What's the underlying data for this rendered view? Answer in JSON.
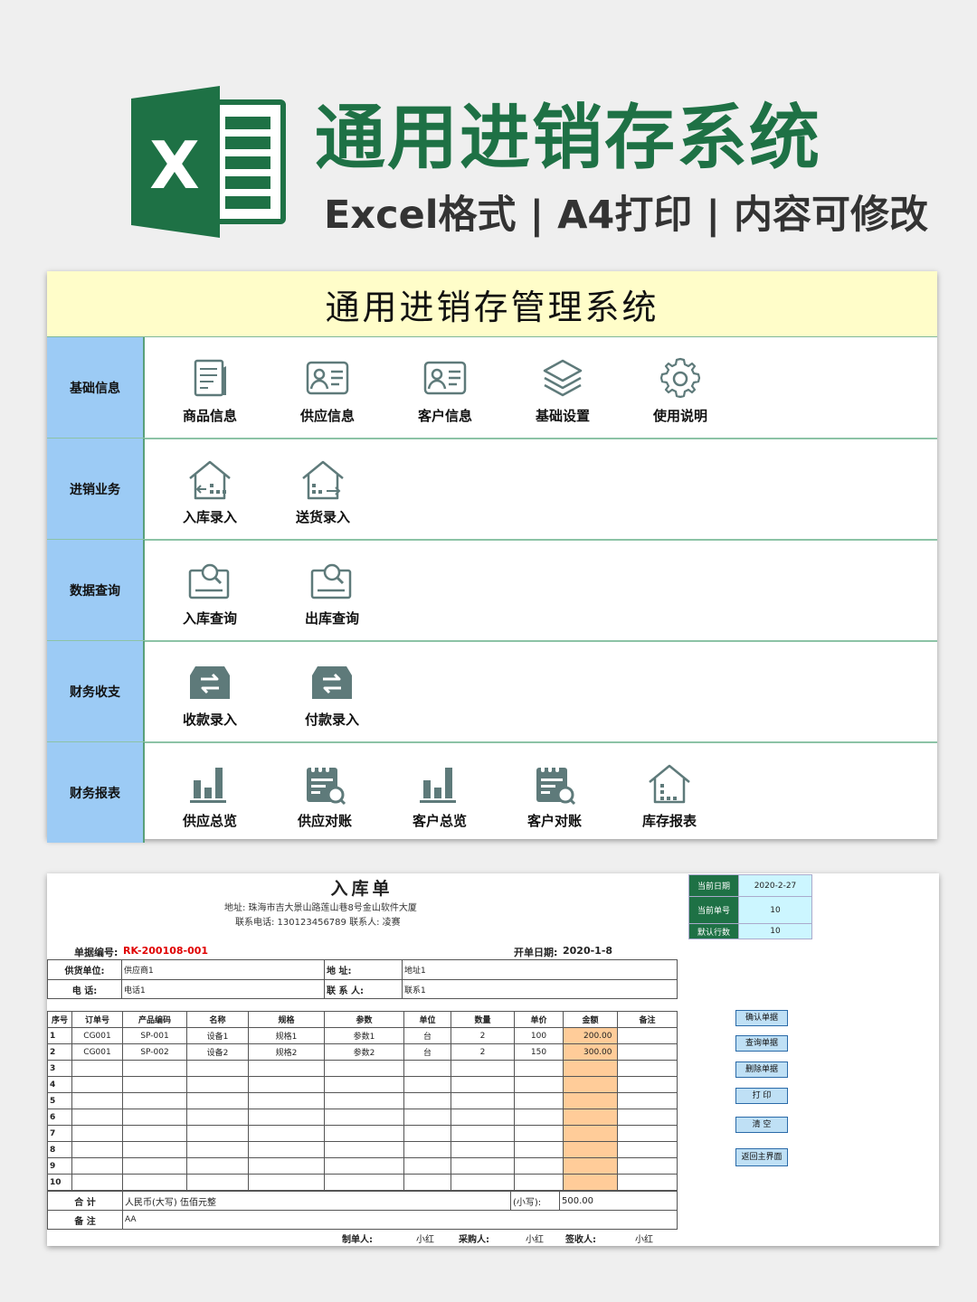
{
  "banner": {
    "title": "通用进销存系统",
    "subtitle": "Excel格式 | A4打印 | 内容可修改",
    "logo_letter": "X",
    "brand_color": "#1e7145"
  },
  "menu": {
    "title": "通用进销存管理系统",
    "rows": [
      {
        "category": "基础信息",
        "items": [
          {
            "label": "商品信息",
            "icon": "document-icon"
          },
          {
            "label": "供应信息",
            "icon": "id-card-icon"
          },
          {
            "label": "客户信息",
            "icon": "id-card-icon"
          },
          {
            "label": "基础设置",
            "icon": "layers-icon"
          },
          {
            "label": "使用说明",
            "icon": "gear-icon"
          }
        ]
      },
      {
        "category": "进销业务",
        "items": [
          {
            "label": "入库录入",
            "icon": "warehouse-in-icon"
          },
          {
            "label": "送货录入",
            "icon": "warehouse-out-icon"
          }
        ]
      },
      {
        "category": "数据查询",
        "items": [
          {
            "label": "入库查询",
            "icon": "search-card-icon"
          },
          {
            "label": "出库查询",
            "icon": "search-card-icon"
          }
        ]
      },
      {
        "category": "财务收支",
        "items": [
          {
            "label": "收款录入",
            "icon": "exchange-icon"
          },
          {
            "label": "付款录入",
            "icon": "exchange-icon"
          }
        ]
      },
      {
        "category": "财务报表",
        "items": [
          {
            "label": "供应总览",
            "icon": "bar-chart-icon"
          },
          {
            "label": "供应对账",
            "icon": "ledger-search-icon"
          },
          {
            "label": "客户总览",
            "icon": "bar-chart-icon"
          },
          {
            "label": "客户对账",
            "icon": "ledger-search-icon"
          },
          {
            "label": "库存报表",
            "icon": "warehouse-icon"
          }
        ]
      }
    ]
  },
  "form": {
    "title": "入库单",
    "address": "地址:  珠海市吉大景山路莲山巷8号金山软件大厦",
    "contact": "联系电话: 130123456789   联系人: 凌赛",
    "doc_no_label": "单据编号:",
    "doc_no": "RK-200108-001",
    "date_label": "开单日期:",
    "date": "2020-1-8",
    "supplier_label": "供货单位:",
    "supplier": "供应商1",
    "address_label": "地   址:",
    "address_value": "地址1",
    "phone_label": "电   话:",
    "phone": "电话1",
    "person_label": "联 系 人:",
    "person": "联系1",
    "columns": [
      "序号",
      "订单号",
      "产品编码",
      "名称",
      "规格",
      "参数",
      "单位",
      "数量",
      "单价",
      "金额",
      "备注"
    ],
    "rows": [
      [
        "1",
        "CG001",
        "SP-001",
        "设备1",
        "规格1",
        "参数1",
        "台",
        "2",
        "100",
        "200.00",
        ""
      ],
      [
        "2",
        "CG001",
        "SP-002",
        "设备2",
        "规格2",
        "参数2",
        "台",
        "2",
        "150",
        "300.00",
        ""
      ],
      [
        "3",
        "",
        "",
        "",
        "",
        "",
        "",
        "",
        "",
        "",
        ""
      ],
      [
        "4",
        "",
        "",
        "",
        "",
        "",
        "",
        "",
        "",
        "",
        ""
      ],
      [
        "5",
        "",
        "",
        "",
        "",
        "",
        "",
        "",
        "",
        "",
        ""
      ],
      [
        "6",
        "",
        "",
        "",
        "",
        "",
        "",
        "",
        "",
        "",
        ""
      ],
      [
        "7",
        "",
        "",
        "",
        "",
        "",
        "",
        "",
        "",
        "",
        ""
      ],
      [
        "8",
        "",
        "",
        "",
        "",
        "",
        "",
        "",
        "",
        "",
        ""
      ],
      [
        "9",
        "",
        "",
        "",
        "",
        "",
        "",
        "",
        "",
        "",
        ""
      ],
      [
        "10",
        "",
        "",
        "",
        "",
        "",
        "",
        "",
        "",
        "",
        ""
      ]
    ],
    "total_label": "合      计",
    "total_cn_label": "人民币(大写)",
    "total_cn": "伍佰元整",
    "total_num_label": "(小写):",
    "total_num": "500.00",
    "remark_label": "备      注",
    "remark": "AA",
    "footer": {
      "maker_label": "制单人:",
      "maker": "小红",
      "buyer_label": "采购人:",
      "buyer": "小红",
      "receiver_label": "签收人:",
      "receiver": "小红"
    },
    "side": [
      {
        "label": "当前日期",
        "value": "2020-2-27"
      },
      {
        "label": "当前单号",
        "value": "10"
      },
      {
        "label": "默认行数",
        "value": "10"
      }
    ],
    "buttons": [
      "确认单据",
      "查询单据",
      "删除单据",
      "打   印",
      "清   空",
      "返回主界面"
    ]
  }
}
